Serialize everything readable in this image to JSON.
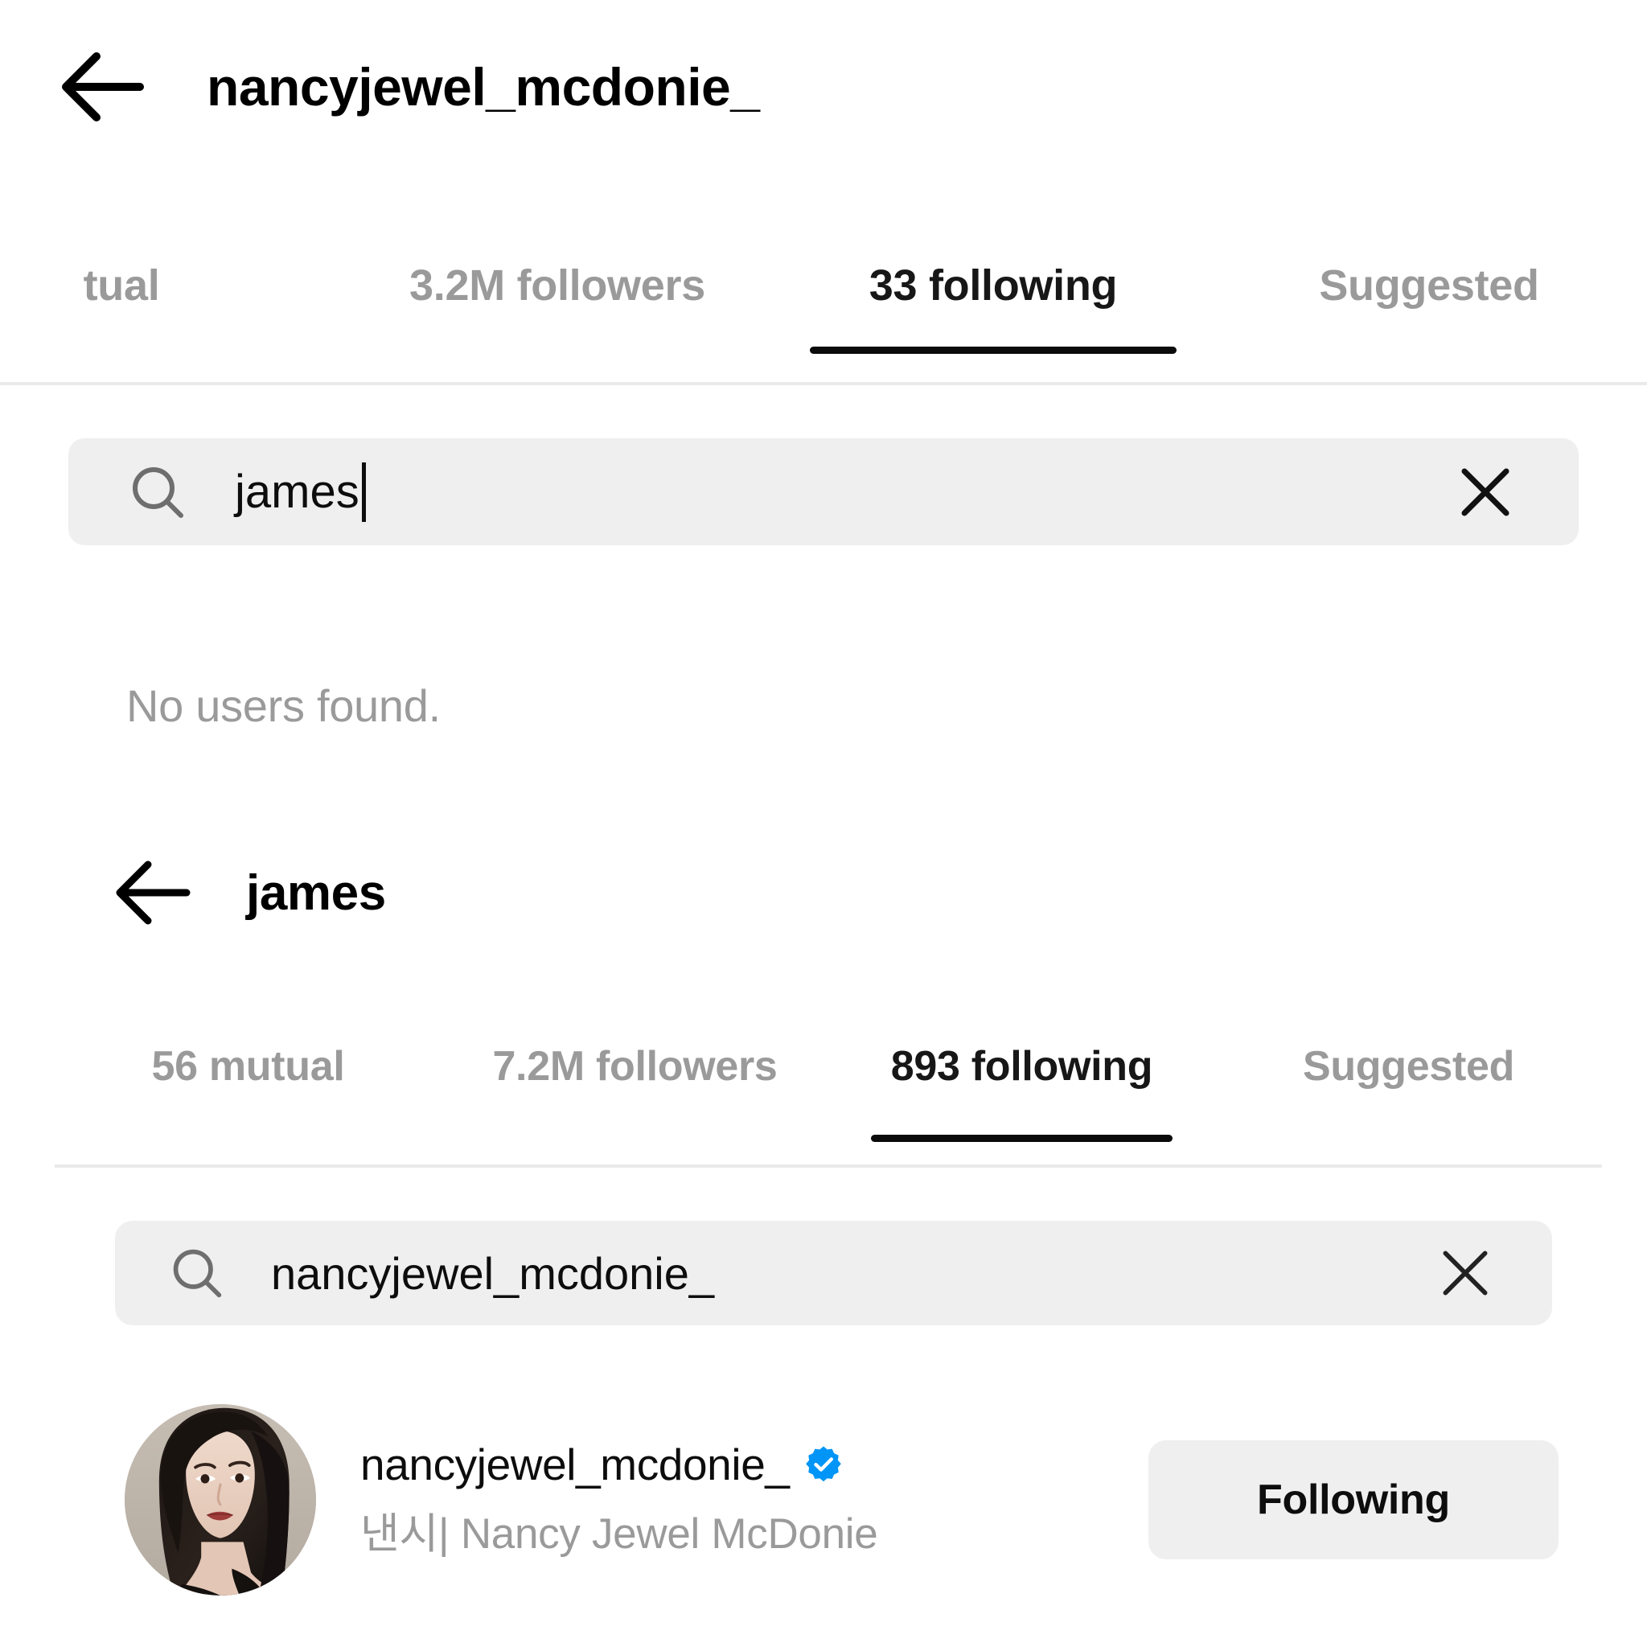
{
  "outer_screen": {
    "back_icon": "back-arrow-icon",
    "title": "nancyjewel_mcdonie_",
    "tabs": [
      {
        "label": "tual",
        "active": false
      },
      {
        "label": "3.2M followers",
        "active": false
      },
      {
        "label": "33 following",
        "active": true
      },
      {
        "label": "Suggested",
        "active": false
      }
    ],
    "search": {
      "icon": "search-icon",
      "value": "james",
      "placeholder": "Search",
      "clear_icon": "close-icon"
    },
    "empty_state": "No users found."
  },
  "inner_screen": {
    "back_icon": "back-arrow-icon",
    "title": "james",
    "tabs": [
      {
        "label": "56 mutual",
        "active": false
      },
      {
        "label": "7.2M followers",
        "active": false
      },
      {
        "label": "893 following",
        "active": true
      },
      {
        "label": "Suggested",
        "active": false
      }
    ],
    "search": {
      "icon": "search-icon",
      "value": "nancyjewel_mcdonie_",
      "placeholder": "Search",
      "clear_icon": "close-icon"
    },
    "results": [
      {
        "avatar": "user-avatar-photo",
        "username": "nancyjewel_mcdonie_",
        "verified": true,
        "verified_icon": "verified-badge-icon",
        "full_name": "낸시| Nancy Jewel McDonie",
        "action_label": "Following"
      }
    ]
  },
  "colors": {
    "accent_verified": "#0095F6",
    "field_background": "#EFEFEF",
    "muted_text": "#9A9A9A",
    "primary_text": "#0D0D0D",
    "divider": "#EAEAEA",
    "active_underline": "#0B0B0B"
  }
}
